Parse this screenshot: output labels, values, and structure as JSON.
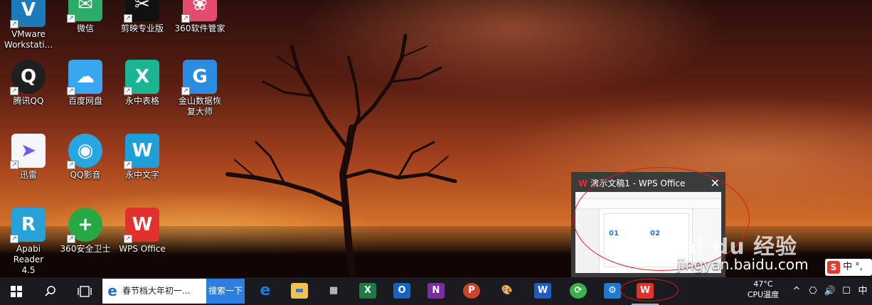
{
  "desktop": {
    "icons": [
      {
        "label": "VMware Workstati...",
        "color": "#1d7ab8",
        "glyph": "V"
      },
      {
        "label": "微信",
        "color": "#2aae67",
        "glyph": "✉"
      },
      {
        "label": "剪映专业版",
        "color": "#111111",
        "glyph": "✂"
      },
      {
        "label": "360软件管家",
        "color": "#e34c6c",
        "glyph": "❀"
      },
      {
        "label": "腾讯QQ",
        "color": "#1f1f1f",
        "glyph": "Q"
      },
      {
        "label": "百度网盘",
        "color": "#3aa6f0",
        "glyph": "☁"
      },
      {
        "label": "永中表格",
        "color": "#1bb594",
        "glyph": "X"
      },
      {
        "label": "金山数据恢复大师",
        "color": "#2c8ce0",
        "glyph": "G"
      },
      {
        "label": "迅雷",
        "color": "#f4f6fb",
        "glyph": "➤"
      },
      {
        "label": "QQ影音",
        "color": "#28a6e2",
        "glyph": "◉"
      },
      {
        "label": "永中文字",
        "color": "#1e9fd9",
        "glyph": "W"
      },
      {
        "label": "Apabi Reader 4.5",
        "color": "#28a0d8",
        "glyph": "R"
      },
      {
        "label": "360安全卫士",
        "color": "#27a845",
        "glyph": "+"
      },
      {
        "label": "WPS Office",
        "color": "#e0312b",
        "glyph": "W"
      }
    ]
  },
  "preview": {
    "title": "演示文稿1 - WPS Office",
    "logo": "W",
    "close": "✕",
    "slide_num_1": "01",
    "slide_num_2": "02"
  },
  "watermark": {
    "brand": "Bai du 经验",
    "url": "jingyan.baidu.com"
  },
  "ime": {
    "logo": "S",
    "label": "中 °,"
  },
  "taskbar": {
    "start_icon": "windows-icon",
    "search_icon": "search-icon",
    "taskview_icon": "task-view-icon",
    "search_query": "春节档大年初一...",
    "search_button": "搜索一下",
    "apps": [
      {
        "name": "edge",
        "glyph": "e",
        "color": "#1e78d6"
      },
      {
        "name": "file-explorer",
        "glyph": "▬",
        "color": "#f2c14e"
      },
      {
        "name": "store",
        "glyph": "▦",
        "color": "#2b2b2b"
      },
      {
        "name": "excel",
        "glyph": "X",
        "color": "#1d7a44"
      },
      {
        "name": "outlook",
        "glyph": "O",
        "color": "#1565c0"
      },
      {
        "name": "onenote",
        "glyph": "N",
        "color": "#7b2ca0"
      },
      {
        "name": "powerpoint",
        "glyph": "P",
        "color": "#c9432a"
      },
      {
        "name": "paint",
        "glyph": "🎨",
        "color": "#d9cdb5"
      },
      {
        "name": "word",
        "glyph": "W",
        "color": "#1f5cbf"
      },
      {
        "name": "360-browser",
        "glyph": "⟳",
        "color": "#37b34a"
      },
      {
        "name": "settings",
        "glyph": "⚙",
        "color": "#1e78d6"
      },
      {
        "name": "wps-office",
        "glyph": "W",
        "color": "#e0312b"
      }
    ],
    "temperature": "47°C",
    "temperature_label": "CPU温度",
    "tray": {
      "chevron": "^",
      "network": "⎔",
      "volume": "🔊",
      "notes": "☐",
      "lang": "中"
    }
  }
}
